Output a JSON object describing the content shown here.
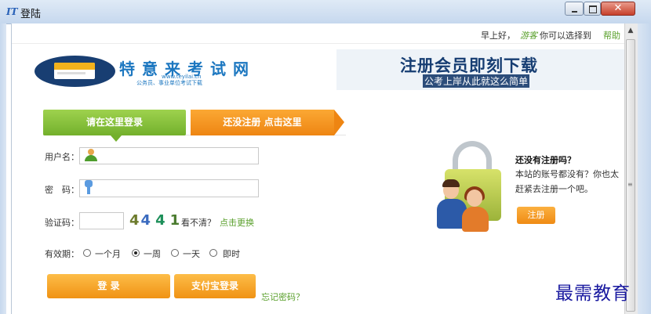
{
  "window": {
    "title": "登陆",
    "icon_label": "IT",
    "close_glyph": "✕"
  },
  "topbar": {
    "greeting": "早上好，",
    "visitor": "游客",
    "choose_text": "你可以选择到",
    "help_label": "帮助"
  },
  "logo": {
    "name": "特意来考试网",
    "url": "www.teyilai.cn",
    "tagline": "公务员、事业单位考试下载"
  },
  "banner": {
    "main": "注册会员即刻下载",
    "sub": "公考上岸从此就这么简单"
  },
  "tabs": {
    "login": "请在这里登录",
    "register": "还没注册 点击这里"
  },
  "form": {
    "username_label": "用户名：",
    "password_label": "密　码：",
    "captcha_label": "验证码：",
    "captcha_chars": [
      "4",
      "4",
      "4",
      "1"
    ],
    "captcha_unclear": "看不清？",
    "captcha_change": "点击更换",
    "validity_label": "有效期：",
    "validity_options": [
      {
        "label": "一个月",
        "selected": false
      },
      {
        "label": "一周",
        "selected": true
      },
      {
        "label": "一天",
        "selected": false
      },
      {
        "label": "即时",
        "selected": false
      }
    ],
    "login_button": "登 录",
    "alipay_button": "支付宝登录",
    "forgot_link": "忘记密码？"
  },
  "promo": {
    "title": "还没有注册吗？",
    "line1": "本站的账号都没有？你也太",
    "line2": "赶紧去注册一个吧。",
    "register_button": "注册"
  },
  "watermark": "最需教育",
  "scrollbar": {
    "up_glyph": "▲",
    "grip_glyph": "≡"
  },
  "colors": {
    "accent_green": "#73b02c",
    "accent_orange": "#ee8512",
    "link_green": "#5aa02c",
    "navy": "#163d72"
  }
}
